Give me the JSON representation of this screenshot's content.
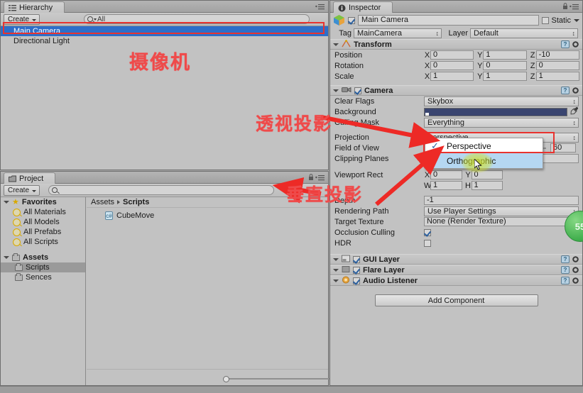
{
  "hierarchy": {
    "tab_label": "Hierarchy",
    "tab_icon": "hierarchy-icon",
    "create_label": "Create",
    "search_value": "All",
    "items": [
      {
        "label": "Main Camera",
        "selected": true
      },
      {
        "label": "Directional Light",
        "selected": false
      }
    ]
  },
  "project": {
    "tab_label": "Project",
    "tab_icon": "folder-icon",
    "create_label": "Create",
    "search_value": "",
    "favorites_label": "Favorites",
    "favorites": [
      {
        "label": "All Materials"
      },
      {
        "label": "All Models"
      },
      {
        "label": "All Prefabs"
      },
      {
        "label": "All Scripts"
      }
    ],
    "assets_label": "Assets",
    "folders": [
      {
        "label": "Scripts",
        "selected": true
      },
      {
        "label": "Sences",
        "selected": false
      }
    ],
    "breadcrumb": [
      "Assets",
      "Scripts"
    ],
    "files": [
      {
        "label": "CubeMove",
        "icon": "csharp-script-icon"
      }
    ]
  },
  "inspector": {
    "tab_label": "Inspector",
    "tab_icon": "info-icon",
    "object_name": "Main Camera",
    "object_enabled": true,
    "static_label": "Static",
    "static_checked": false,
    "tag_label": "Tag",
    "tag_value": "MainCamera",
    "layer_label": "Layer",
    "layer_value": "Default",
    "transform": {
      "title": "Transform",
      "rows": [
        {
          "label": "Position",
          "x": "0",
          "y": "1",
          "z": "-10"
        },
        {
          "label": "Rotation",
          "x": "0",
          "y": "0",
          "z": "0"
        },
        {
          "label": "Scale",
          "x": "1",
          "y": "1",
          "z": "1"
        }
      ]
    },
    "camera": {
      "title": "Camera",
      "enabled": true,
      "clear_flags_label": "Clear Flags",
      "clear_flags_value": "Skybox",
      "background_label": "Background",
      "background_color": "#3a4570",
      "culling_mask_label": "Culling Mask",
      "culling_mask_value": "Everything",
      "projection_label": "Projection",
      "projection_value": "Perspective",
      "fov_label": "Field of View",
      "fov_value": "60",
      "clipping_label": "Clipping Planes",
      "viewport_label": "Viewport Rect",
      "viewport_x": "0",
      "viewport_y": "0",
      "viewport_w": "1",
      "viewport_h": "1",
      "depth_label": "Depth",
      "depth_value": "-1",
      "rendering_path_label": "Rendering Path",
      "rendering_path_value": "Use Player Settings",
      "target_texture_label": "Target Texture",
      "target_texture_value": "None (Render Texture)",
      "occlusion_label": "Occlusion Culling",
      "occlusion_checked": true,
      "hdr_label": "HDR",
      "hdr_checked": false
    },
    "components": [
      {
        "title": "GUI Layer",
        "enabled": true,
        "icon": "gui-layer-icon"
      },
      {
        "title": "Flare Layer",
        "enabled": true,
        "icon": "flare-layer-icon"
      },
      {
        "title": "Audio Listener",
        "enabled": true,
        "icon": "audio-listener-icon"
      }
    ],
    "add_component_label": "Add Component"
  },
  "dropdown": {
    "name": "projection-dropdown",
    "options": [
      {
        "label": "Perspective",
        "checked": true,
        "highlighted": false
      },
      {
        "label": "Orthographic",
        "checked": false,
        "highlighted": true
      }
    ]
  },
  "annotations": [
    {
      "name": "annotation-camera",
      "text": "摄像机"
    },
    {
      "name": "annotation-perspective-projection",
      "text": "透视投影"
    },
    {
      "name": "annotation-orthographic-projection",
      "text": "垂直投影"
    }
  ],
  "watermark": {
    "text": "55"
  },
  "colors": {
    "accent_red": "#e8332f",
    "selection_blue": "#2d6ec9",
    "highlight_blue": "#b5d7f2",
    "annotation_red": "#ef4a4a"
  }
}
